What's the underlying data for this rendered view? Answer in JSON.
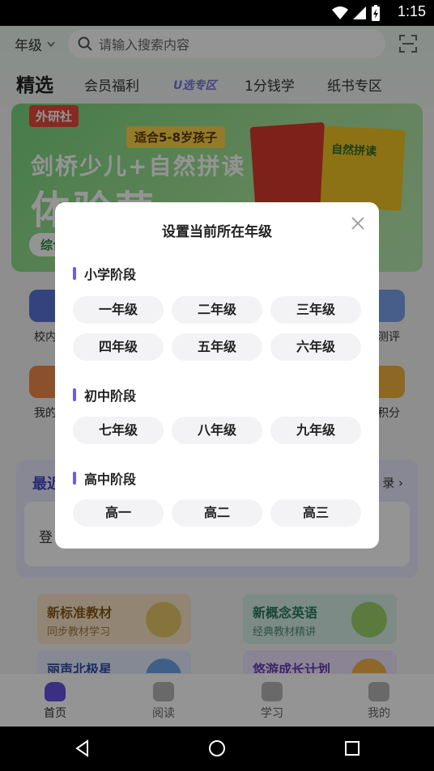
{
  "status_bar": {
    "time": "1:15"
  },
  "header": {
    "grade_selector": "年级",
    "search_placeholder": "请输入搜索内容"
  },
  "tabs": [
    {
      "label": "精选"
    },
    {
      "label": "会员福利"
    },
    {
      "label": "U选专区"
    },
    {
      "label": "1分钱学"
    },
    {
      "label": "纸书专区"
    }
  ],
  "banner": {
    "publisher": "外研社",
    "age_tag": "适合5-8岁孩子",
    "headline": "剑桥少儿+自然拼读",
    "headline_big": "体验营",
    "pill": "综合",
    "book_text": "自然拼读"
  },
  "grid": {
    "items": [
      {
        "label": "校内"
      },
      {
        "label": "测评"
      },
      {
        "label": "我的"
      },
      {
        "label": "积分"
      }
    ]
  },
  "recent": {
    "title": "最近",
    "link": "录",
    "card_text": "登"
  },
  "features": [
    {
      "title": "新标准教材",
      "subtitle": "同步教材学习",
      "color": "#fbe6c8"
    },
    {
      "title": "新概念英语",
      "subtitle": "经典教材精讲",
      "color": "#d6f0e6"
    },
    {
      "title": "丽声北极星",
      "subtitle": "",
      "color": "#e6ecff"
    },
    {
      "title": "悠游成长计划",
      "subtitle": "",
      "color": "#efe4ff"
    }
  ],
  "bottom_nav": [
    {
      "label": "首页",
      "active": true
    },
    {
      "label": "阅读",
      "active": false
    },
    {
      "label": "学习",
      "active": false
    },
    {
      "label": "我的",
      "active": false
    }
  ],
  "modal": {
    "title": "设置当前所在年级",
    "sections": [
      {
        "label": "小学阶段",
        "grades": [
          "一年级",
          "二年级",
          "三年级",
          "四年级",
          "五年级",
          "六年级"
        ]
      },
      {
        "label": "初中阶段",
        "grades": [
          "七年级",
          "八年级",
          "九年级"
        ]
      },
      {
        "label": "高中阶段",
        "grades": [
          "高一",
          "高二",
          "高三"
        ]
      }
    ]
  },
  "colors": {
    "accent": "#6c5ce7",
    "banner_green": "#79d67f",
    "overlay": "rgba(0,0,0,0.42)"
  }
}
